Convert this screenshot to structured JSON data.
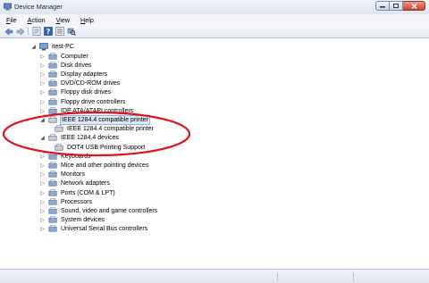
{
  "window": {
    "title": "Device Manager"
  },
  "menu": {
    "file": {
      "u": "F",
      "rest": "ile"
    },
    "action": {
      "u": "A",
      "rest": "ction"
    },
    "view": {
      "u": "V",
      "rest": "iew"
    },
    "help": {
      "u": "H",
      "rest": "elp"
    }
  },
  "toolbar": {
    "back_icon": "back-arrow-icon",
    "forward_icon": "forward-arrow-icon",
    "properties_icon": "properties-icon",
    "help_icon": "help-icon",
    "view_icon": "view-icon",
    "scan_icon": "scan-hardware-icon"
  },
  "tree": {
    "root": "itest-PC",
    "items": [
      {
        "label": "Computer",
        "state": "collapsed",
        "icon": "computer-icon"
      },
      {
        "label": "Disk drives",
        "state": "collapsed",
        "icon": "disk-drive-icon"
      },
      {
        "label": "Display adapters",
        "state": "collapsed",
        "icon": "display-adapter-icon"
      },
      {
        "label": "DVD/CD-ROM drives",
        "state": "collapsed",
        "icon": "dvd-drive-icon"
      },
      {
        "label": "Floppy disk drives",
        "state": "collapsed",
        "icon": "floppy-drive-icon"
      },
      {
        "label": "Floppy drive controllers",
        "state": "collapsed",
        "icon": "controller-icon"
      },
      {
        "label": "IDE ATA/ATAPI controllers",
        "state": "collapsed",
        "icon": "ide-controller-icon"
      },
      {
        "label": "IEEE 1284.4 compatible printer",
        "state": "expanded",
        "icon": "printer-icon",
        "selected": true
      },
      {
        "label": "IEEE 1284.4 compatible printer",
        "state": "child",
        "icon": "printer-icon"
      },
      {
        "label": "IEEE 1284.4 devices",
        "state": "expanded",
        "icon": "printer-icon"
      },
      {
        "label": "DOT4 USB Printing Support",
        "state": "child",
        "icon": "usb-printer-icon"
      },
      {
        "label": "Keyboards",
        "state": "collapsed",
        "icon": "keyboard-icon"
      },
      {
        "label": "Mice and other pointing devices",
        "state": "collapsed",
        "icon": "mouse-icon"
      },
      {
        "label": "Monitors",
        "state": "collapsed",
        "icon": "monitor-icon"
      },
      {
        "label": "Network adapters",
        "state": "collapsed",
        "icon": "network-adapter-icon"
      },
      {
        "label": "Ports (COM & LPT)",
        "state": "collapsed",
        "icon": "port-icon"
      },
      {
        "label": "Processors",
        "state": "collapsed",
        "icon": "processor-icon"
      },
      {
        "label": "Sound, video and game controllers",
        "state": "collapsed",
        "icon": "sound-icon"
      },
      {
        "label": "System devices",
        "state": "collapsed",
        "icon": "system-device-icon"
      },
      {
        "label": "Universal Serial Bus controllers",
        "state": "collapsed",
        "icon": "usb-icon"
      }
    ]
  },
  "annotation": {
    "color": "#e0101c"
  },
  "colors": {
    "selection": "#dde8f6",
    "close_button": "#c3492f"
  }
}
